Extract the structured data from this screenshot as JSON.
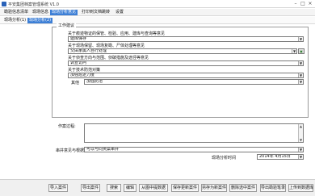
{
  "window": {
    "title": "平安集团档案管理系统 V1.0",
    "minimize": "–",
    "maximize": "□",
    "close": "×"
  },
  "menu": [
    "勘验信息清单",
    "现场信息",
    "现场分析意见",
    "打印到文档跳转",
    "设置"
  ],
  "tabs": [
    "现场分析(1)",
    "现场分析(2)"
  ],
  "form": {
    "group_title": "工作建议",
    "q1_label": "关于痕迹物证的保管、检验、应用、建库与查询等意见",
    "q1_value": "建库保存",
    "q2_label": "关于现场保留、现场复勘、尸体处理等意见",
    "q2_value": "交由家属人自行处理",
    "q3_label": "关于侦查方向与范围、侦破措施及途径等意见",
    "q3_value": "调查访问",
    "q4_label": "关于技术防范对策",
    "q4_value": "加强巡逻力度",
    "other_label": "其他",
    "other_value": "加强防范",
    "process_label": "作案过程:",
    "reason_label": "串并意见与根据:",
    "reason_value": "可以与同类案串并",
    "date_label": "现场分析时间",
    "date_value": "2014年  4月15日"
  },
  "toolbar": [
    "导入案件",
    "导出案件",
    "搜索",
    "编辑",
    "从图中提数据",
    "保存更新案件",
    "另存为新案件",
    "删除选中案件",
    "导出勘验笔录",
    "上传到数据库"
  ]
}
